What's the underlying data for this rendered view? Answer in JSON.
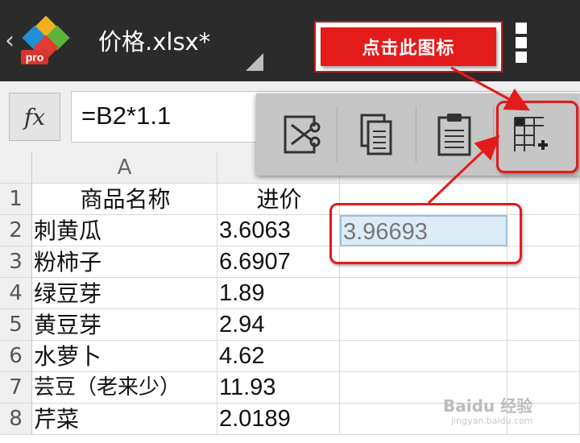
{
  "app": {
    "filename": "价格.xlsx*",
    "logo_badge": "pro",
    "accent_color": "#e41b1b"
  },
  "callout": {
    "text": "点击此图标"
  },
  "formula_bar": {
    "fx_label": "fx",
    "formula": "=B2*1.1"
  },
  "toolbar": {
    "icons": [
      "cut-icon",
      "copy-icon",
      "paste-icon",
      "insert-cells-icon"
    ]
  },
  "sheet": {
    "columns": [
      "A",
      "",
      "",
      ""
    ],
    "rows": [
      {
        "num": "1",
        "a": "商品名称",
        "b": "进价",
        "c": ""
      },
      {
        "num": "2",
        "a": "刺黄瓜",
        "b": "3.6063",
        "c": "3.96693"
      },
      {
        "num": "3",
        "a": "粉柿子",
        "b": "6.6907",
        "c": ""
      },
      {
        "num": "4",
        "a": "绿豆芽",
        "b": "1.89",
        "c": ""
      },
      {
        "num": "5",
        "a": "黄豆芽",
        "b": "2.94",
        "c": ""
      },
      {
        "num": "6",
        "a": "水萝卜",
        "b": "4.62",
        "c": ""
      },
      {
        "num": "7",
        "a": "芸豆（老来少）",
        "b": "11.93",
        "c": ""
      },
      {
        "num": "8",
        "a": "芹菜",
        "b": "2.0189",
        "c": ""
      }
    ]
  },
  "watermark": {
    "text": "Baidu 经验",
    "sub": "jingyan.baidu.com"
  }
}
